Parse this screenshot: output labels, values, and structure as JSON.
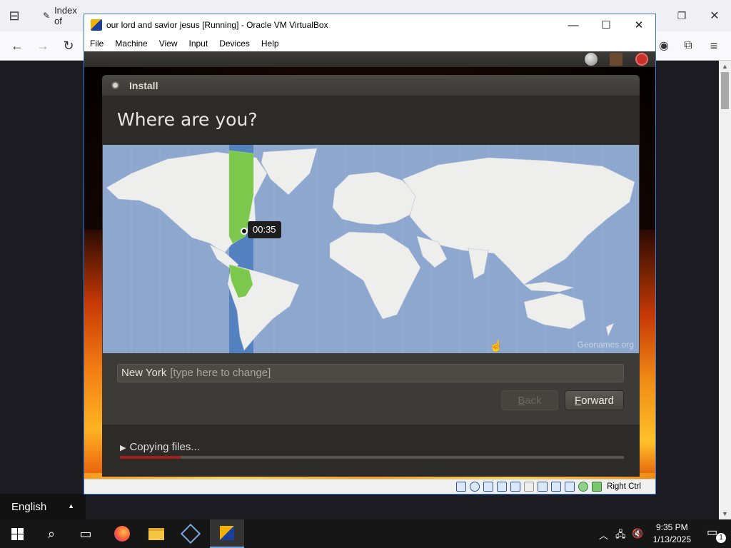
{
  "browser": {
    "tabs": [
      {
        "label": "Index of"
      }
    ],
    "icons": [
      "tab-list-icon",
      "back-arrow-icon",
      "forward-arrow-icon",
      "reload-icon",
      "account-icon",
      "extensions-icon",
      "menu-icon",
      "restore-icon",
      "close-icon"
    ]
  },
  "vbox": {
    "title": "our lord and savior jesus [Running] - Oracle VM VirtualBox",
    "controls": {
      "minimize": "—",
      "maximize": "☐",
      "close": "✕"
    },
    "menu": [
      "File",
      "Machine",
      "View",
      "Input",
      "Devices",
      "Help"
    ],
    "host_key": "Right Ctrl"
  },
  "installer": {
    "window_title": "Install",
    "heading": "Where are you?",
    "timezone_time": "00:35",
    "map_attribution": "Geonames.org",
    "location_value": "New York",
    "location_placeholder": "[type here to change]",
    "back_label": "Back",
    "forward_label": "Forward",
    "progress_label": "Copying files...",
    "progress_fraction": 0.12
  },
  "language_bar": {
    "label": "English"
  },
  "taskbar": {
    "time": "9:35 PM",
    "date": "1/13/2025",
    "notification_count": "1",
    "apps": [
      "windows-start-icon",
      "search-icon",
      "task-view-icon",
      "firefox-icon",
      "file-explorer-icon",
      "virtualbox-icon",
      "virtualbox-vm-icon"
    ]
  },
  "colors": {
    "ubuntu_bg": "#3c3b37",
    "map_ocean": "#8ea7cf",
    "timezone_band": "#4a7bbd",
    "highlight_land": "#7cc84d",
    "progress": "#a31e1e"
  }
}
